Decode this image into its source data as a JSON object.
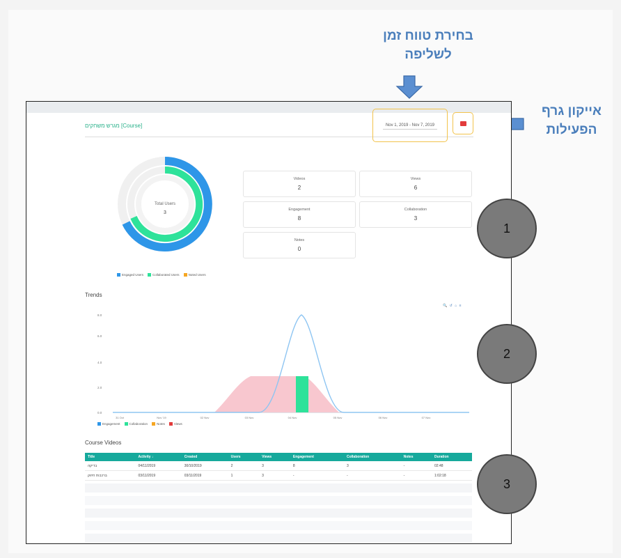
{
  "callouts": {
    "date_range": [
      "בחירת טווח זמן",
      "לשליפה"
    ],
    "activity_icon": [
      "אייקון גרף",
      "הפעילות"
    ]
  },
  "header": {
    "title": "מגרש משחקים [Course]",
    "date_range": "Nov 1, 2019 - Nov 7, 2019"
  },
  "donut": {
    "center_label": "Total Users",
    "center_value": "3",
    "legend": [
      {
        "label": "Engaged Users",
        "color": "#2e96e8"
      },
      {
        "label": "Collaborated Users",
        "color": "#2ee29a"
      },
      {
        "label": "Noted Users",
        "color": "#f5a623"
      }
    ]
  },
  "stats": [
    {
      "label": "Videos",
      "value": "2"
    },
    {
      "label": "Views",
      "value": "6"
    },
    {
      "label": "Engagement",
      "value": "8"
    },
    {
      "label": "Collaboration",
      "value": "3"
    },
    {
      "label": "Notes",
      "value": "0"
    }
  ],
  "trends": {
    "title": "Trends",
    "tools": "🔍 ↺ ⌂ ≡",
    "legend": [
      {
        "label": "Engagement",
        "color": "#2e96e8"
      },
      {
        "label": "Collaboration",
        "color": "#2ee29a"
      },
      {
        "label": "Notes",
        "color": "#f5a623"
      },
      {
        "label": "Views",
        "color": "#e23b3b"
      }
    ]
  },
  "chart_data": {
    "type": "area",
    "x": [
      "31 Oct",
      "Nov '19",
      "02 Nov",
      "03 Nov",
      "04 Nov",
      "05 Nov",
      "06 Nov",
      "07 Nov"
    ],
    "y_ticks": [
      "0.0",
      "2.0",
      "4.0",
      "6.0",
      "8.0"
    ],
    "ylim": [
      0,
      8
    ],
    "series": [
      {
        "name": "Engagement",
        "type": "line",
        "color": "#8ec5f2"
      },
      {
        "name": "Views",
        "type": "area",
        "color": "#f8c7cf"
      },
      {
        "name": "Collaboration",
        "type": "bar",
        "color": "#2ee29a"
      }
    ]
  },
  "videos": {
    "title": "Course Videos",
    "columns": [
      "Title",
      "Activity ↓",
      "Created",
      "Users",
      "Views",
      "Engagement",
      "Collaboration",
      "Notes",
      "Duration"
    ],
    "rows": [
      [
        "בדיקה",
        "04/11/2019",
        "30/10/2019",
        "2",
        "3",
        "8",
        "3",
        "-",
        "02:48"
      ],
      [
        "ברכבות חיזוק",
        "03/11/2019",
        "03/11/2019",
        "1",
        "3",
        "-",
        "-",
        "-",
        "1:02:18"
      ]
    ]
  },
  "markers": [
    "1",
    "2",
    "3"
  ]
}
